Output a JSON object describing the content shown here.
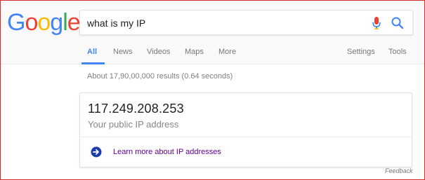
{
  "logo": {
    "letters": [
      "G",
      "o",
      "o",
      "g",
      "l",
      "e"
    ]
  },
  "search": {
    "query": "what is my IP"
  },
  "tabs": {
    "all": "All",
    "news": "News",
    "videos": "Videos",
    "maps": "Maps",
    "more": "More",
    "settings": "Settings",
    "tools": "Tools"
  },
  "results_count": "About 17,90,00,000 results (0.64 seconds)",
  "ip_card": {
    "ip_address": "117.249.208.253",
    "label": "Your public IP address",
    "learn_more": "Learn more about IP addresses"
  },
  "feedback": "Feedback",
  "colors": {
    "accent_blue": "#4285f4",
    "link_purple": "#660099",
    "mic_red": "#ea4335",
    "arrow_blue": "#1a3fa8"
  },
  "icons": {
    "mic": "mic-icon",
    "search": "search-icon",
    "arrow": "arrow-right-circle-icon"
  }
}
